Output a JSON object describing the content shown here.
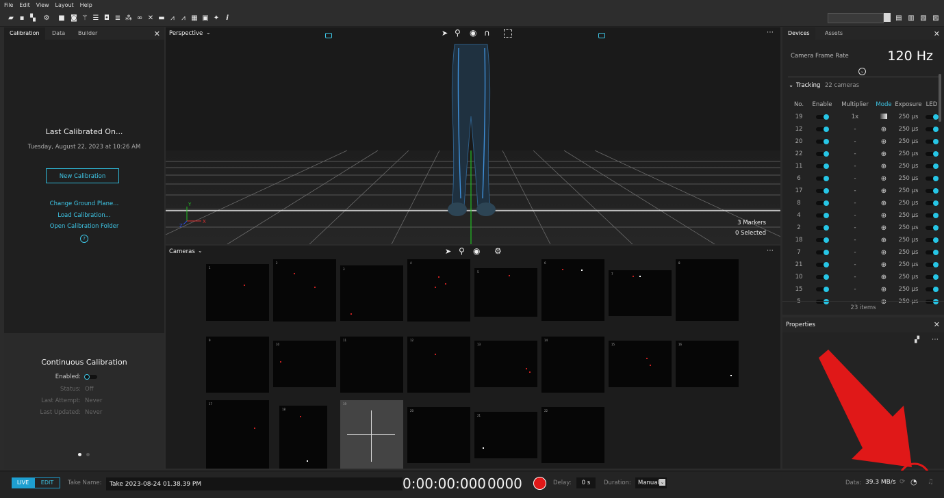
{
  "menu": [
    "File",
    "Edit",
    "View",
    "Layout",
    "Help"
  ],
  "left_panel": {
    "tabs": [
      "Calibration",
      "Data",
      "Builder"
    ],
    "last_calibrated_title": "Last Calibrated On...",
    "last_calibrated_date": "Tuesday, August 22, 2023 at 10:26 AM",
    "new_calibration": "New Calibration",
    "links": [
      "Change Ground Plane...",
      "Load Calibration...",
      "Open Calibration Folder"
    ],
    "continuous": {
      "title": "Continuous Calibration",
      "enabled_label": "Enabled:",
      "status_label": "Status:",
      "status_value": "Off",
      "last_attempt_label": "Last Attempt:",
      "last_attempt_value": "Never",
      "last_updated_label": "Last Updated:",
      "last_updated_value": "Never"
    }
  },
  "viewport": {
    "title": "Perspective",
    "markers": "3 Markers",
    "selected": "0 Selected"
  },
  "cameras_view": {
    "title": "Cameras",
    "tiles": [
      "1",
      "2",
      "3",
      "4",
      "5",
      "6",
      "7",
      "8",
      "9",
      "10",
      "11",
      "12",
      "13",
      "14",
      "15",
      "16",
      "17",
      "18",
      "19",
      "20",
      "21",
      "22"
    ],
    "tile_label": "Object",
    "tile_label_19": "Grayscale"
  },
  "devices": {
    "tabs": [
      "Devices",
      "Assets"
    ],
    "frame_rate_label": "Camera Frame Rate",
    "frame_rate_value": "120 Hz",
    "tracking_label": "Tracking",
    "tracking_count": "22 cameras",
    "columns": [
      "No.",
      "Enable",
      "Multiplier",
      "Mode",
      "Exposure",
      "LED"
    ],
    "rows": [
      {
        "no": "19",
        "mult": "1x",
        "mode": "grayscale",
        "exp": "250 µs"
      },
      {
        "no": "12",
        "mult": "-",
        "mode": "object",
        "exp": "250 µs"
      },
      {
        "no": "20",
        "mult": "-",
        "mode": "object",
        "exp": "250 µs"
      },
      {
        "no": "22",
        "mult": "-",
        "mode": "object",
        "exp": "250 µs"
      },
      {
        "no": "11",
        "mult": "-",
        "mode": "object",
        "exp": "250 µs"
      },
      {
        "no": "6",
        "mult": "-",
        "mode": "object",
        "exp": "250 µs"
      },
      {
        "no": "17",
        "mult": "-",
        "mode": "object",
        "exp": "250 µs"
      },
      {
        "no": "8",
        "mult": "-",
        "mode": "object",
        "exp": "250 µs"
      },
      {
        "no": "4",
        "mult": "-",
        "mode": "object",
        "exp": "250 µs"
      },
      {
        "no": "2",
        "mult": "-",
        "mode": "object",
        "exp": "250 µs"
      },
      {
        "no": "18",
        "mult": "-",
        "mode": "object",
        "exp": "250 µs"
      },
      {
        "no": "7",
        "mult": "-",
        "mode": "object",
        "exp": "250 µs"
      },
      {
        "no": "21",
        "mult": "-",
        "mode": "object",
        "exp": "250 µs"
      },
      {
        "no": "10",
        "mult": "-",
        "mode": "object",
        "exp": "250 µs"
      },
      {
        "no": "15",
        "mult": "-",
        "mode": "object",
        "exp": "250 µs"
      },
      {
        "no": "5",
        "mult": "-",
        "mode": "object",
        "exp": "250 µs"
      }
    ],
    "items_count": "23 items"
  },
  "properties": {
    "title": "Properties"
  },
  "status": {
    "live": "LIVE",
    "edit": "EDIT",
    "take_name_label": "Take Name:",
    "take_name_value": "Take 2023-08-24 01.38.39 PM",
    "timecode": "0:00:00:000",
    "frame": "0000",
    "delay_label": "Delay:",
    "delay_value": "0 s",
    "duration_label": "Duration:",
    "duration_value": "Manual",
    "data_label": "Data:",
    "data_value": "39.3 MB/s"
  },
  "colors": {
    "accent": "#3ec6e6",
    "record": "#e01818",
    "annotation": "#e01818"
  }
}
